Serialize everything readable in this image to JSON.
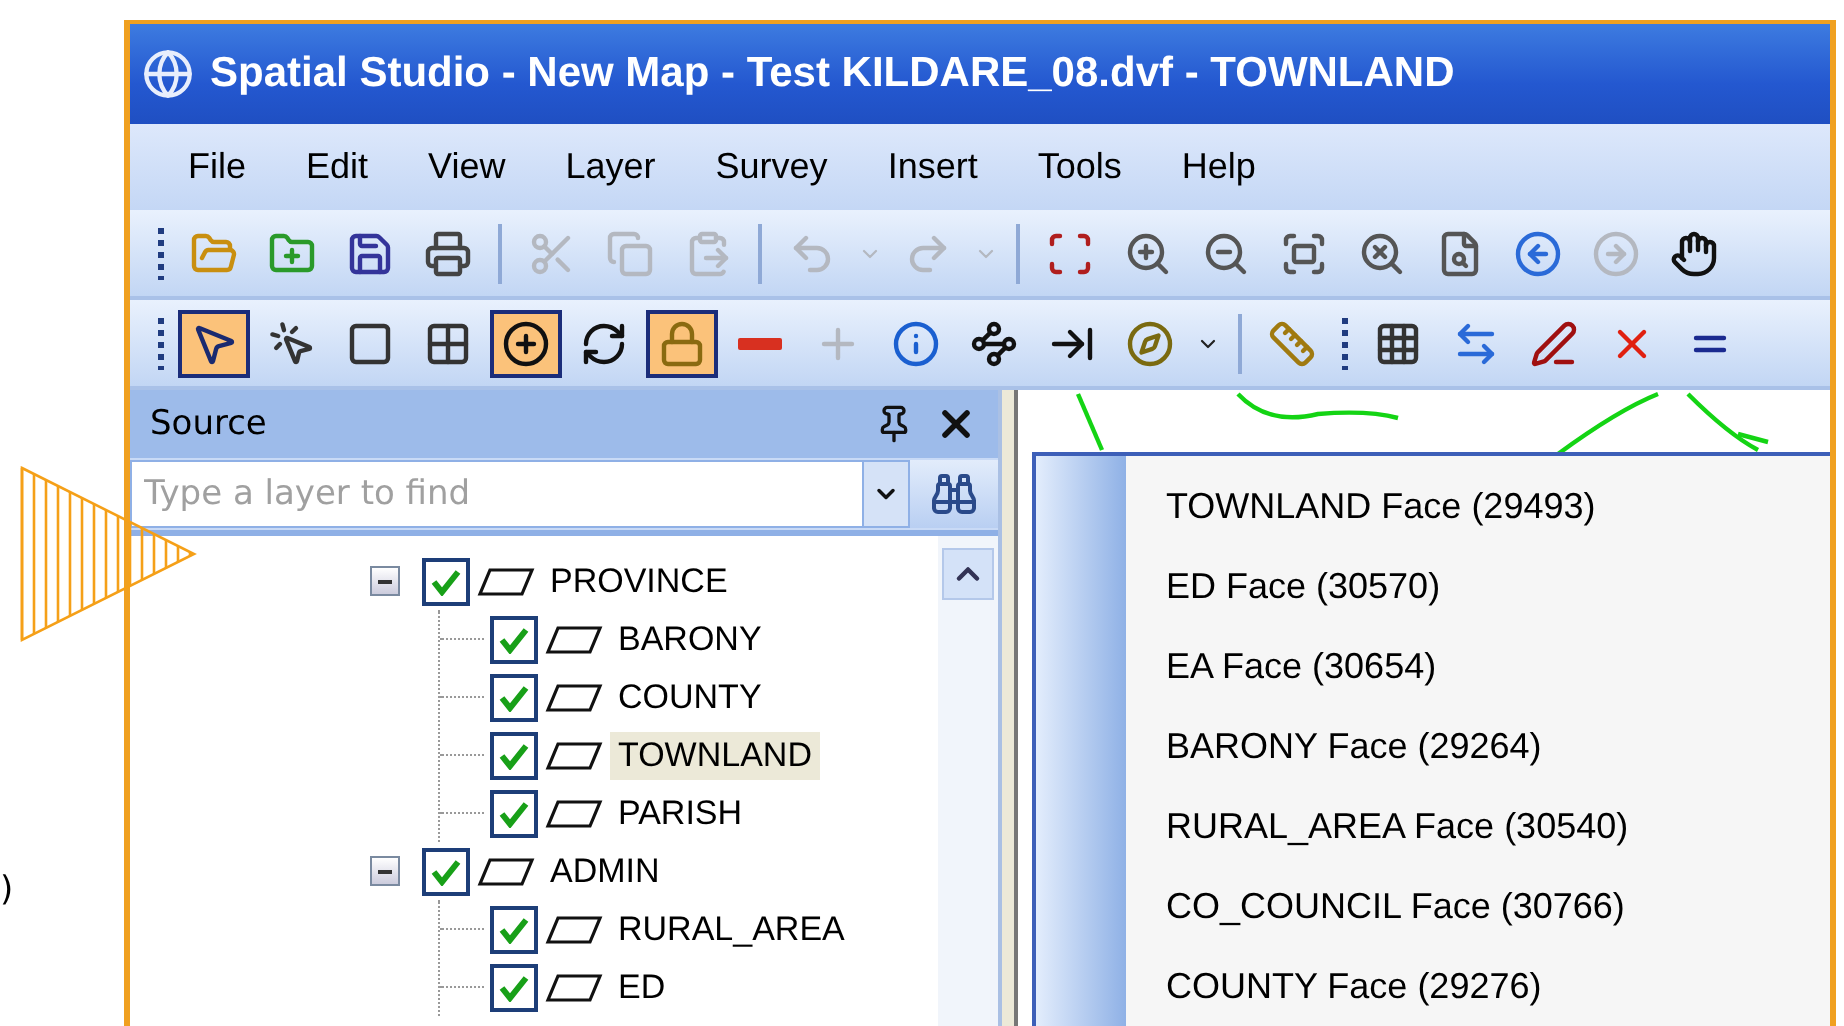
{
  "margin_text": ")",
  "window": {
    "title": "Spatial Studio - New Map - Test KILDARE_08.dvf - TOWNLAND"
  },
  "menu": [
    "File",
    "Edit",
    "View",
    "Layer",
    "Survey",
    "Insert",
    "Tools",
    "Help"
  ],
  "toolbar_1": [
    {
      "kind": "grip"
    },
    {
      "kind": "open",
      "disabled": false
    },
    {
      "kind": "add-layer",
      "disabled": false
    },
    {
      "kind": "save",
      "disabled": false
    },
    {
      "kind": "print",
      "disabled": false
    },
    {
      "kind": "separator"
    },
    {
      "kind": "cut",
      "disabled": true
    },
    {
      "kind": "copy",
      "disabled": true
    },
    {
      "kind": "paste",
      "disabled": true
    },
    {
      "kind": "separator"
    },
    {
      "kind": "undo",
      "disabled": true
    },
    {
      "kind": "caret",
      "disabled": true
    },
    {
      "kind": "redo",
      "disabled": true
    },
    {
      "kind": "caret",
      "disabled": true
    },
    {
      "kind": "separator"
    },
    {
      "kind": "zoom-extent",
      "disabled": false
    },
    {
      "kind": "zoom-in",
      "disabled": false
    },
    {
      "kind": "zoom-out",
      "disabled": false
    },
    {
      "kind": "zoom-fit",
      "disabled": false
    },
    {
      "kind": "zoom-clear",
      "disabled": false
    },
    {
      "kind": "zoom-page",
      "disabled": false
    },
    {
      "kind": "zoom-back",
      "disabled": false
    },
    {
      "kind": "zoom-forward",
      "disabled": true
    },
    {
      "kind": "pan",
      "disabled": false
    }
  ],
  "toolbar_2": [
    {
      "kind": "grip"
    },
    {
      "kind": "pointer",
      "pressed": true
    },
    {
      "kind": "select-multi",
      "pressed": false
    },
    {
      "kind": "select-rect",
      "pressed": false
    },
    {
      "kind": "select-hatch",
      "pressed": false
    },
    {
      "kind": "add-point",
      "pressed": true
    },
    {
      "kind": "refresh",
      "pressed": false
    },
    {
      "kind": "lock",
      "pressed": true
    },
    {
      "kind": "minus",
      "pressed": false
    },
    {
      "kind": "plus",
      "pressed": false,
      "disabled": true
    },
    {
      "kind": "info",
      "pressed": false
    },
    {
      "kind": "nodes",
      "pressed": false
    },
    {
      "kind": "arrow-node",
      "pressed": false
    },
    {
      "kind": "compass",
      "pressed": false
    },
    {
      "kind": "caret",
      "pressed": false
    },
    {
      "kind": "separator"
    },
    {
      "kind": "measure",
      "pressed": false
    },
    {
      "kind": "grip"
    },
    {
      "kind": "xy",
      "pressed": false
    },
    {
      "kind": "swap",
      "pressed": false
    },
    {
      "kind": "edit-line",
      "pressed": false
    },
    {
      "kind": "delete-vertex",
      "pressed": false
    },
    {
      "kind": "lines",
      "pressed": false
    }
  ],
  "source_panel": {
    "title": "Source",
    "search": {
      "placeholder": "Type a layer to find"
    },
    "tree": [
      {
        "label": "PROVINCE",
        "checked": true,
        "selected": false,
        "expanded": true,
        "children": [
          {
            "label": "BARONY",
            "checked": true,
            "selected": false
          },
          {
            "label": "COUNTY",
            "checked": true,
            "selected": false
          },
          {
            "label": "TOWNLAND",
            "checked": true,
            "selected": true
          },
          {
            "label": "PARISH",
            "checked": true,
            "selected": false
          }
        ]
      },
      {
        "label": "ADMIN",
        "checked": true,
        "selected": false,
        "expanded": true,
        "children": [
          {
            "label": "RURAL_AREA",
            "checked": true,
            "selected": false
          },
          {
            "label": "ED",
            "checked": true,
            "selected": false
          }
        ]
      }
    ]
  },
  "context_menu": [
    "TOWNLAND Face (29493)",
    "ED Face (30570)",
    "EA Face (30654)",
    "BARONY Face (29264)",
    "RURAL_AREA Face (30540)",
    "CO_COUNCIL Face (30766)",
    "COUNTY Face (29276)"
  ]
}
